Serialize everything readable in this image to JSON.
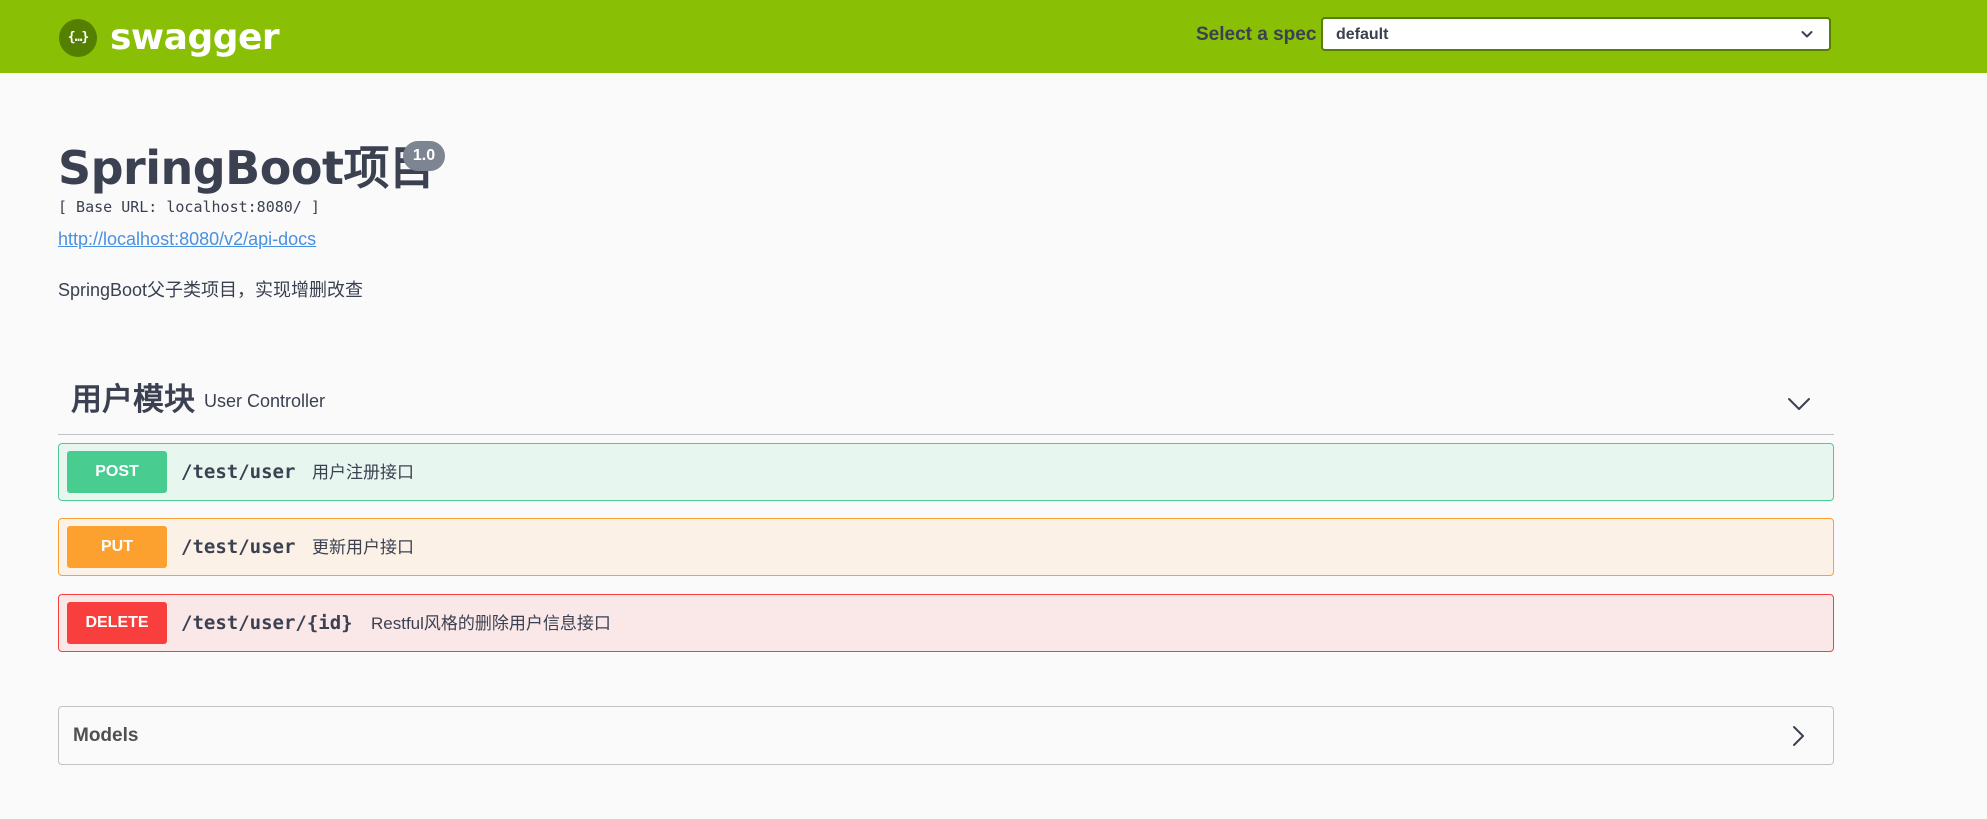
{
  "topbar": {
    "logo_icon": "{…}",
    "logo_text": "swagger",
    "spec_label": "Select a spec",
    "spec_selected": "default",
    "spec_chevron_icon": "chevron-down-icon",
    "color": "#89bf04"
  },
  "info": {
    "title": "SpringBoot项目",
    "version": "1.0",
    "base_url": "[ Base URL: localhost:8080/ ]",
    "api_docs_link": "http://localhost:8080/v2/api-docs",
    "description": "SpringBoot父子类项目，实现增删改查"
  },
  "tag": {
    "name": "用户模块",
    "description": "User Controller",
    "chevron_icon": "chevron-down-icon"
  },
  "operations": [
    {
      "method": "POST",
      "path": "/test/user",
      "summary": "用户注册接口",
      "color": "#49cc90"
    },
    {
      "method": "PUT",
      "path": "/test/user",
      "summary": "更新用户接口",
      "color": "#fca130"
    },
    {
      "method": "DELETE",
      "path": "/test/user/{id}",
      "summary": "Restful风格的删除用户信息接口",
      "color": "#f93e3e"
    }
  ],
  "models": {
    "title": "Models",
    "chevron_icon": "chevron-right-icon"
  }
}
